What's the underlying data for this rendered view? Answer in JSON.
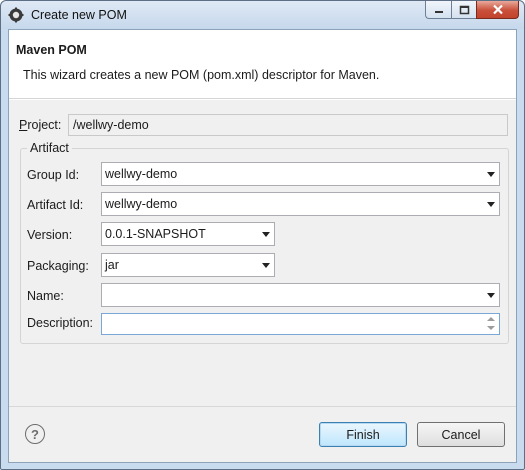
{
  "window": {
    "title": "Create new POM"
  },
  "banner": {
    "title": "Maven POM",
    "description": "This wizard creates a new POM (pom.xml) descriptor for Maven."
  },
  "project": {
    "label_prefix": "P",
    "label_rest": "roject:",
    "value": "/wellwy-demo"
  },
  "artifact": {
    "group_title": "Artifact",
    "group_id": {
      "label": "Group Id:",
      "value": "wellwy-demo"
    },
    "artifact_id": {
      "label": "Artifact Id:",
      "value": "wellwy-demo"
    },
    "version": {
      "label": "Version:",
      "value": "0.0.1-SNAPSHOT"
    },
    "packaging": {
      "label": "Packaging:",
      "value": "jar"
    },
    "name": {
      "label": "Name:",
      "value": ""
    },
    "description": {
      "label": "Description:",
      "value": ""
    }
  },
  "buttons": {
    "finish": "Finish",
    "cancel": "Cancel"
  },
  "icons": {
    "app": "eclipse-gear-icon",
    "help": "help-icon",
    "minimize": "minimize-icon",
    "maximize": "maximize-icon",
    "close": "close-icon"
  }
}
